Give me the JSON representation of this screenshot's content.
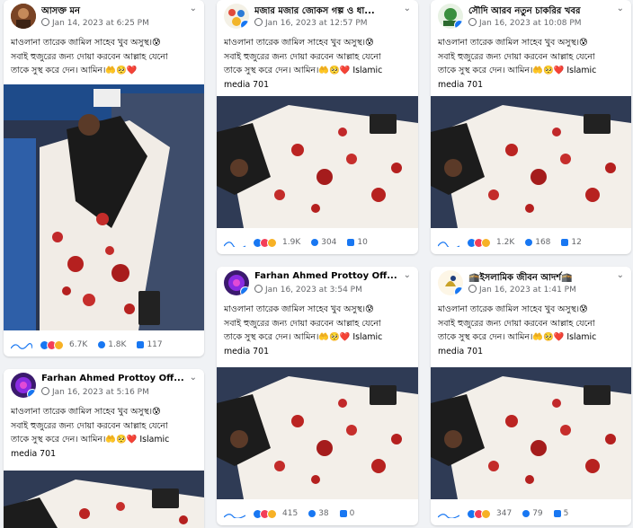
{
  "colors": {
    "facebook_blue": "#1877f2",
    "like": "#1877f2",
    "love": "#f33e58",
    "haha": "#f7b125"
  },
  "post_text": {
    "line1": "মাওলানা তারেক জামিল সাহেব খুব অসুস্থ।😰",
    "line2": "সবাই হুজুরের জন্য দোয়া করবেন আল্লাহ যেনো",
    "line3": "তাকে সুস্থ করে দেন। আমিন।🤲🥺❤️",
    "tag_label": "Islamic",
    "tag_media": "media 701"
  },
  "posts": [
    {
      "name": "আসক্ত মন",
      "time": "Jan 14, 2023 at 6:25 PM",
      "reactions": "6.7K",
      "comments": "1.8K",
      "shares": "117"
    },
    {
      "name": "মজার মজার জোকস গল্প ও ধা...",
      "time": "Jan 16, 2023 at 12:57 PM",
      "reactions": "1.9K",
      "comments": "304",
      "shares": "10"
    },
    {
      "name": "সৌদি আরব নতুন চাকরির খবর",
      "time": "Jan 16, 2023 at 10:08 PM",
      "reactions": "1.2K",
      "comments": "168",
      "shares": "12"
    },
    {
      "name": "Farhan Ahmed Prottoy Off...",
      "time": "Jan 16, 2023 at 3:54 PM",
      "reactions": "415",
      "comments": "38",
      "shares": "0"
    },
    {
      "name": "🕋ইসলামিক জীবন আদর্শ🕋",
      "time": "Jan 16, 2023 at 1:41 PM",
      "reactions": "347",
      "comments": "79",
      "shares": "5"
    },
    {
      "name": "Farhan Ahmed Prottoy Off...",
      "time": "Jan 16, 2023 at 5:16 PM"
    }
  ]
}
